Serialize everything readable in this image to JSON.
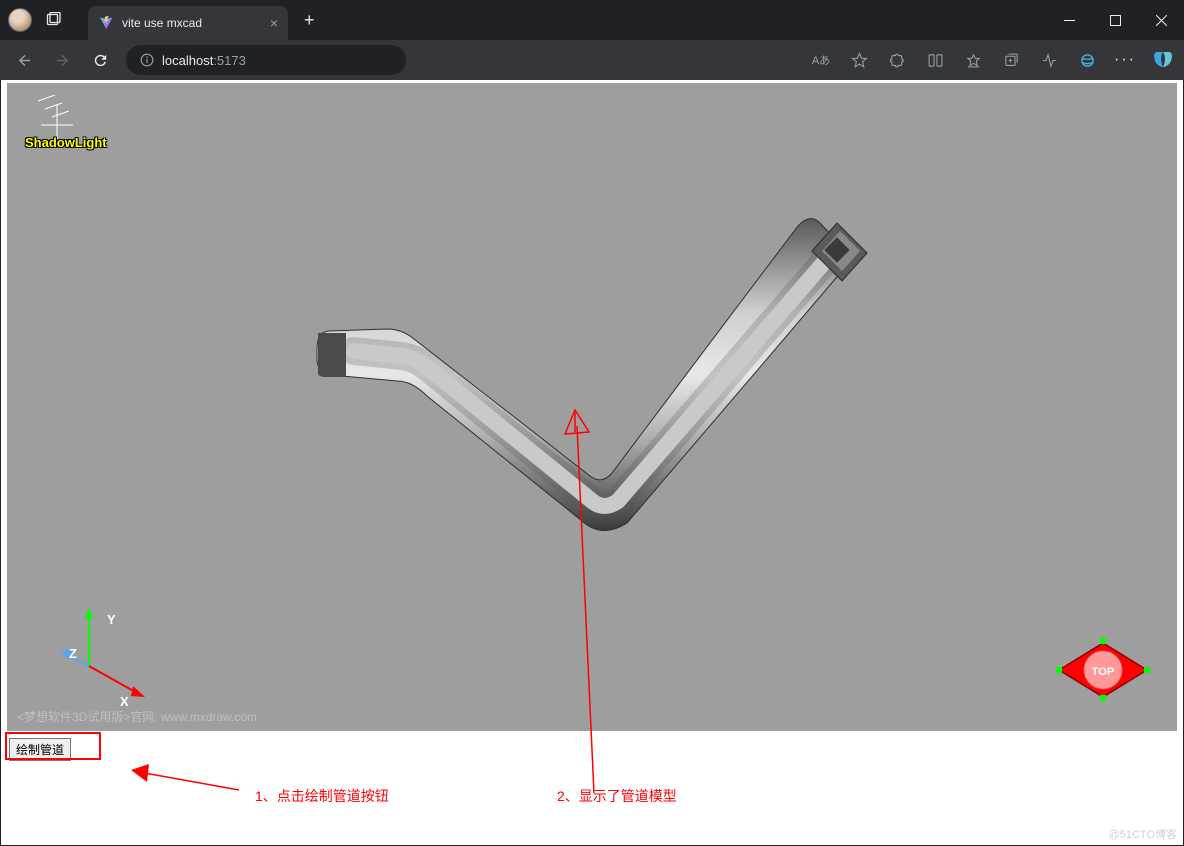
{
  "tab": {
    "title": "vite use mxcad"
  },
  "url": {
    "host": "localhost",
    "port": ":5173"
  },
  "addr_badge": "Aあ",
  "canvas": {
    "shadow_label": "ShadowLight",
    "axes": {
      "x": "X",
      "y": "Y",
      "z": "Z"
    },
    "view_cube_face": "TOP",
    "watermark": "<梦想软件3D试用版>官网: www.mxdraw.com"
  },
  "button": {
    "draw_pipe": "绘制管道"
  },
  "annotations": {
    "step1": "1、点击绘制管道按钮",
    "step2": "2、显示了管道模型"
  },
  "blog_mark": "@51CTO博客"
}
